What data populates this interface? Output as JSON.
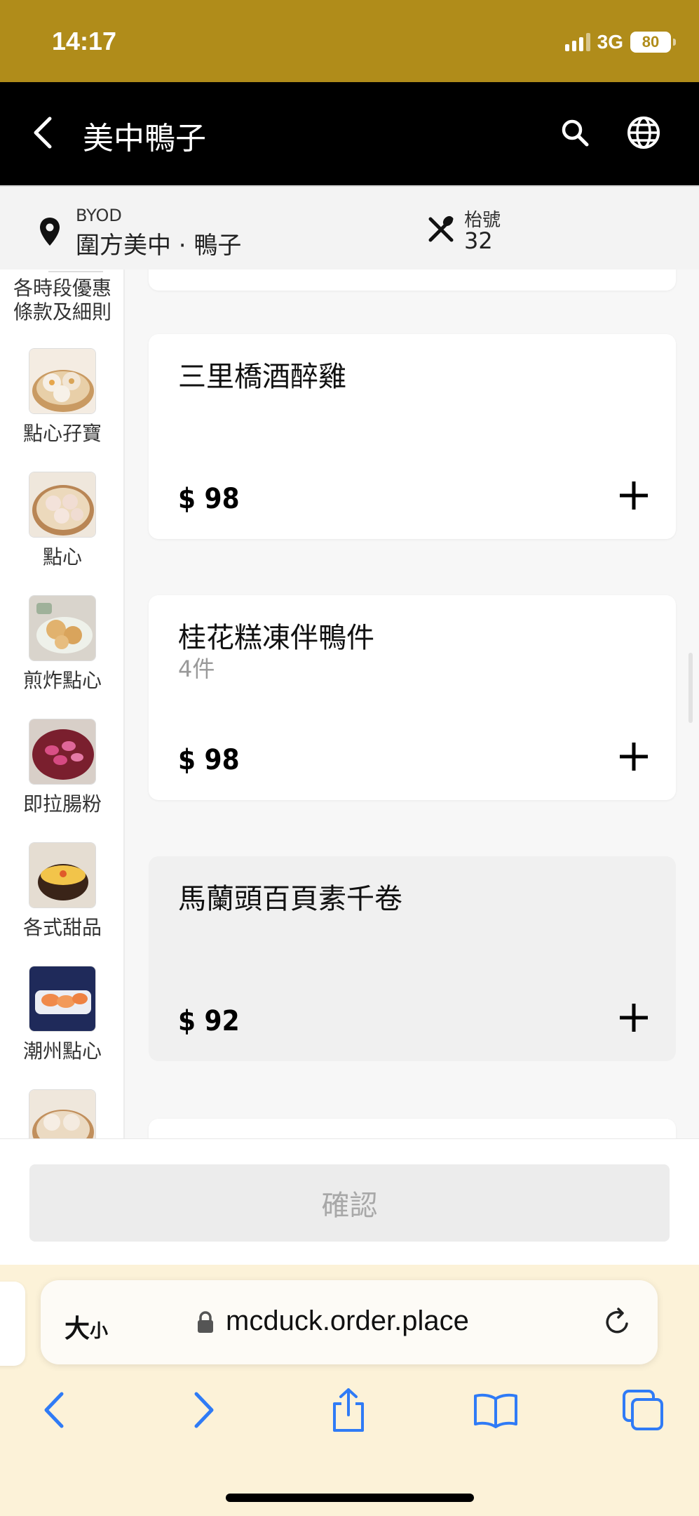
{
  "status": {
    "time": "14:17",
    "network": "3G",
    "battery": "80"
  },
  "nav": {
    "title": "美中鴨子"
  },
  "info": {
    "mode": "BYOD",
    "shop": "圍方美中 · 鴨子",
    "table_label": "枱號",
    "table_no": "32"
  },
  "sidebar": {
    "top_label": "各時段優惠條款及細則",
    "categories": [
      {
        "label": "點心孖寶",
        "icon": "dumpling-basket-image"
      },
      {
        "label": "點心",
        "icon": "har-gow-image"
      },
      {
        "label": "煎炸點心",
        "icon": "fried-dimsum-image"
      },
      {
        "label": "即拉腸粉",
        "icon": "rice-roll-image"
      },
      {
        "label": "各式甜品",
        "icon": "dessert-image"
      },
      {
        "label": "潮州點心",
        "icon": "chiuchow-dumpling-image"
      },
      {
        "label": "",
        "icon": "dumpling-basket-image"
      }
    ]
  },
  "menu": {
    "items": [
      {
        "name": "三里橋酒醉雞",
        "sub": "",
        "price": "$ 98"
      },
      {
        "name": "桂花糕凍伴鴨件",
        "sub": "4件",
        "price": "$ 98"
      },
      {
        "name": "馬蘭頭百頁素千卷",
        "sub": "",
        "price": "$ 92"
      }
    ]
  },
  "confirm": {
    "label": "確認"
  },
  "browser": {
    "text_size": "大",
    "text_size_small": "小",
    "url": "mcduck.order.place"
  },
  "colors": {
    "status_bar": "#b08c1a",
    "nav_bar": "#000000",
    "browser_bg": "#fcf2d8",
    "ios_blue": "#2f7bf6"
  }
}
